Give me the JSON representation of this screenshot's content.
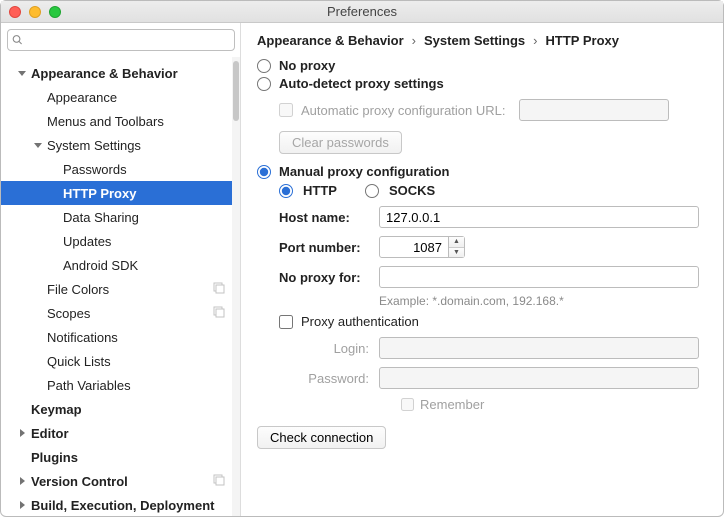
{
  "window": {
    "title": "Preferences"
  },
  "search": {
    "placeholder": ""
  },
  "tree": {
    "items": [
      {
        "label": "Appearance & Behavior",
        "indent": 14,
        "bold": true,
        "arrow": "down"
      },
      {
        "label": "Appearance",
        "indent": 46
      },
      {
        "label": "Menus and Toolbars",
        "indent": 46
      },
      {
        "label": "System Settings",
        "indent": 30,
        "arrow": "down"
      },
      {
        "label": "Passwords",
        "indent": 62
      },
      {
        "label": "HTTP Proxy",
        "indent": 62,
        "bold": true,
        "selected": true
      },
      {
        "label": "Data Sharing",
        "indent": 62
      },
      {
        "label": "Updates",
        "indent": 62
      },
      {
        "label": "Android SDK",
        "indent": 62
      },
      {
        "label": "File Colors",
        "indent": 46,
        "copy": true
      },
      {
        "label": "Scopes",
        "indent": 46,
        "copy": true
      },
      {
        "label": "Notifications",
        "indent": 46
      },
      {
        "label": "Quick Lists",
        "indent": 46
      },
      {
        "label": "Path Variables",
        "indent": 46
      },
      {
        "label": "Keymap",
        "indent": 30,
        "bold": true
      },
      {
        "label": "Editor",
        "indent": 14,
        "bold": true,
        "arrow": "right"
      },
      {
        "label": "Plugins",
        "indent": 30,
        "bold": true
      },
      {
        "label": "Version Control",
        "indent": 14,
        "bold": true,
        "arrow": "right",
        "copy": true
      },
      {
        "label": "Build, Execution, Deployment",
        "indent": 14,
        "bold": true,
        "arrow": "right"
      }
    ]
  },
  "breadcrumb": {
    "a": "Appearance & Behavior",
    "b": "System Settings",
    "c": "HTTP Proxy"
  },
  "proxy": {
    "no_proxy": "No proxy",
    "auto": "Auto-detect proxy settings",
    "auto_url_label": "Automatic proxy configuration URL:",
    "clear_passwords": "Clear passwords",
    "manual": "Manual proxy configuration",
    "http": "HTTP",
    "socks": "SOCKS",
    "host_label": "Host name:",
    "host_value": "127.0.0.1",
    "port_label": "Port number:",
    "port_value": "1087",
    "noproxyfor_label": "No proxy for:",
    "noproxyfor_hint": "Example: *.domain.com, 192.168.*",
    "auth_label": "Proxy authentication",
    "login_label": "Login:",
    "password_label": "Password:",
    "remember": "Remember",
    "check": "Check connection"
  }
}
